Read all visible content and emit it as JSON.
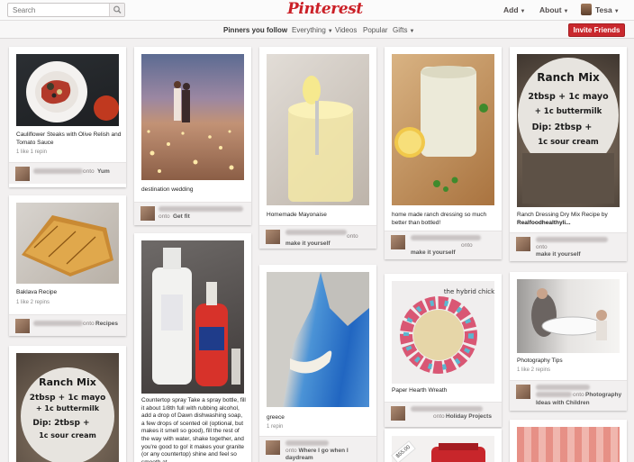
{
  "header": {
    "search_placeholder": "Search",
    "logo": "Pinterest",
    "add": "Add",
    "about": "About",
    "user": "Tesa"
  },
  "subnav": {
    "following": "Pinners you follow",
    "everything": "Everything",
    "videos": "Videos",
    "popular": "Popular",
    "gifts": "Gifts",
    "invite": "Invite Friends"
  },
  "colors": {
    "brand": "#cb2027",
    "invite_button": "#c9282d"
  },
  "pins": [
    {
      "desc": "Cauliflower Steaks with Olive Relish and Tomato Sauce",
      "stats": "1 like  1 repin",
      "board": "Yum",
      "via": "onto"
    },
    {
      "desc": "Baklava Recipe",
      "stats": "1 like  2 repins",
      "board": "Recipes",
      "via": "onto"
    },
    {
      "desc": "destination wedding",
      "board": "Get fit",
      "via": "onto"
    },
    {
      "desc": "Countertop spray Take a spray bottle, fill it about 1/8th full with rubbing alcohol, add a drop of Dawn dishwashing soap, a few drops of scented oil (optional, but makes it smell so good), fill the rest of the way with water, shake together, and you're good to go! it makes your granite (or any countertop) shine and feel so smooth at"
    },
    {
      "desc": "Homemade Mayonaise",
      "board": "make it yourself",
      "via": "onto"
    },
    {
      "desc": "greece",
      "stats": "1 repin",
      "board": "Where I go when I daydream",
      "via": "onto"
    },
    {
      "desc": "home made ranch dressing so much better than bottled!",
      "board": "make it yourself",
      "via": "onto"
    },
    {
      "desc": "Paper Hearth Wreath",
      "board": "Holiday Projects",
      "via": "onto",
      "image_text": "the hybrid chick"
    },
    {
      "price": "$55.00"
    },
    {
      "desc_line1": "Ranch Dressing Dry Mix Recipe by",
      "desc_line2": "Realfoodhealthyli...",
      "board": "make it yourself",
      "via": "onto"
    },
    {
      "desc": "Photography Tips",
      "stats": "1 like  2 repins",
      "board_line1": "Photography",
      "board_line2": "Ideas with Children",
      "via": "onto"
    }
  ],
  "jar_label": {
    "l1": "Ranch Mix",
    "l2": "2tbsp + 1c mayo",
    "l3": "+ 1c buttermilk",
    "l4": "Dip: 2tbsp +",
    "l5": "1c sour cream"
  }
}
